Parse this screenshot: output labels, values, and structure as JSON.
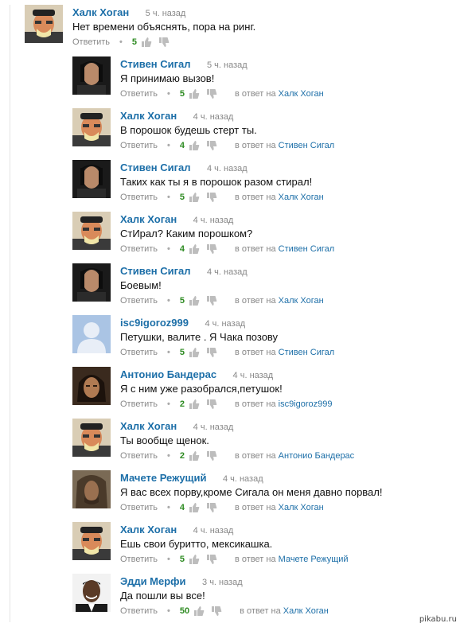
{
  "labels": {
    "reply": "Ответить",
    "in_reply_to": "в ответ на"
  },
  "colors": {
    "author": "#1d6fa8",
    "score": "#2e8b22",
    "meta": "#888888"
  },
  "comments": [
    {
      "author": "Халк Хоган",
      "time": "5 ч. назад",
      "text": "Нет времени объяснять, пора на ринг.",
      "score": "5",
      "in_reply_to": "",
      "avatar": "hulk-hogan-avatar"
    },
    {
      "author": "Стивен Сигал",
      "time": "5 ч. назад",
      "text": "Я принимаю вызов!",
      "score": "5",
      "in_reply_to": "Халк Хоган",
      "avatar": "steven-seagal-avatar"
    },
    {
      "author": "Халк Хоган",
      "time": "4 ч. назад",
      "text": "В порошок будешь стерт ты.",
      "score": "4",
      "in_reply_to": "Стивен Сигал",
      "avatar": "hulk-hogan-avatar"
    },
    {
      "author": "Стивен Сигал",
      "time": "4 ч. назад",
      "text": "Таких как ты я в порошок разом стирал!",
      "score": "5",
      "in_reply_to": "Халк Хоган",
      "avatar": "steven-seagal-avatar"
    },
    {
      "author": "Халк Хоган",
      "time": "4 ч. назад",
      "text": "СтИрал? Каким порошком?",
      "score": "4",
      "in_reply_to": "Стивен Сигал",
      "avatar": "hulk-hogan-avatar"
    },
    {
      "author": "Стивен Сигал",
      "time": "4 ч. назад",
      "text": "Боевым!",
      "score": "5",
      "in_reply_to": "Халк Хоган",
      "avatar": "steven-seagal-avatar"
    },
    {
      "author": "isc9igoroz999",
      "time": "4 ч. назад",
      "text": "Петушки, валите . Я Чака позову",
      "score": "5",
      "in_reply_to": "Стивен Сигал",
      "avatar": "default-user-avatar"
    },
    {
      "author": "Антонио Бандерас",
      "time": "4 ч. назад",
      "text": "Я с ним уже разобрался,петушок!",
      "score": "2",
      "in_reply_to": "isc9igoroz999",
      "avatar": "antonio-banderas-avatar"
    },
    {
      "author": "Халк Хоган",
      "time": "4 ч. назад",
      "text": "Ты вообще щенок.",
      "score": "2",
      "in_reply_to": "Антонио Бандерас",
      "avatar": "hulk-hogan-avatar"
    },
    {
      "author": "Мачете Режущий",
      "time": "4 ч. назад",
      "text": "Я вас всех порву,кроме Сигала он меня давно порвал!",
      "score": "4",
      "in_reply_to": "Халк Хоган",
      "avatar": "machete-avatar"
    },
    {
      "author": "Халк Хоган",
      "time": "4 ч. назад",
      "text": "Ешь свои буритто, мексикашка.",
      "score": "5",
      "in_reply_to": "Мачете Режущий",
      "avatar": "hulk-hogan-avatar"
    },
    {
      "author": "Эдди Мерфи",
      "time": "3 ч. назад",
      "text": "Да пошли вы все!",
      "score": "50",
      "in_reply_to": "Халк Хоган",
      "avatar": "eddie-murphy-avatar"
    }
  ],
  "watermark": "pikabu.ru"
}
